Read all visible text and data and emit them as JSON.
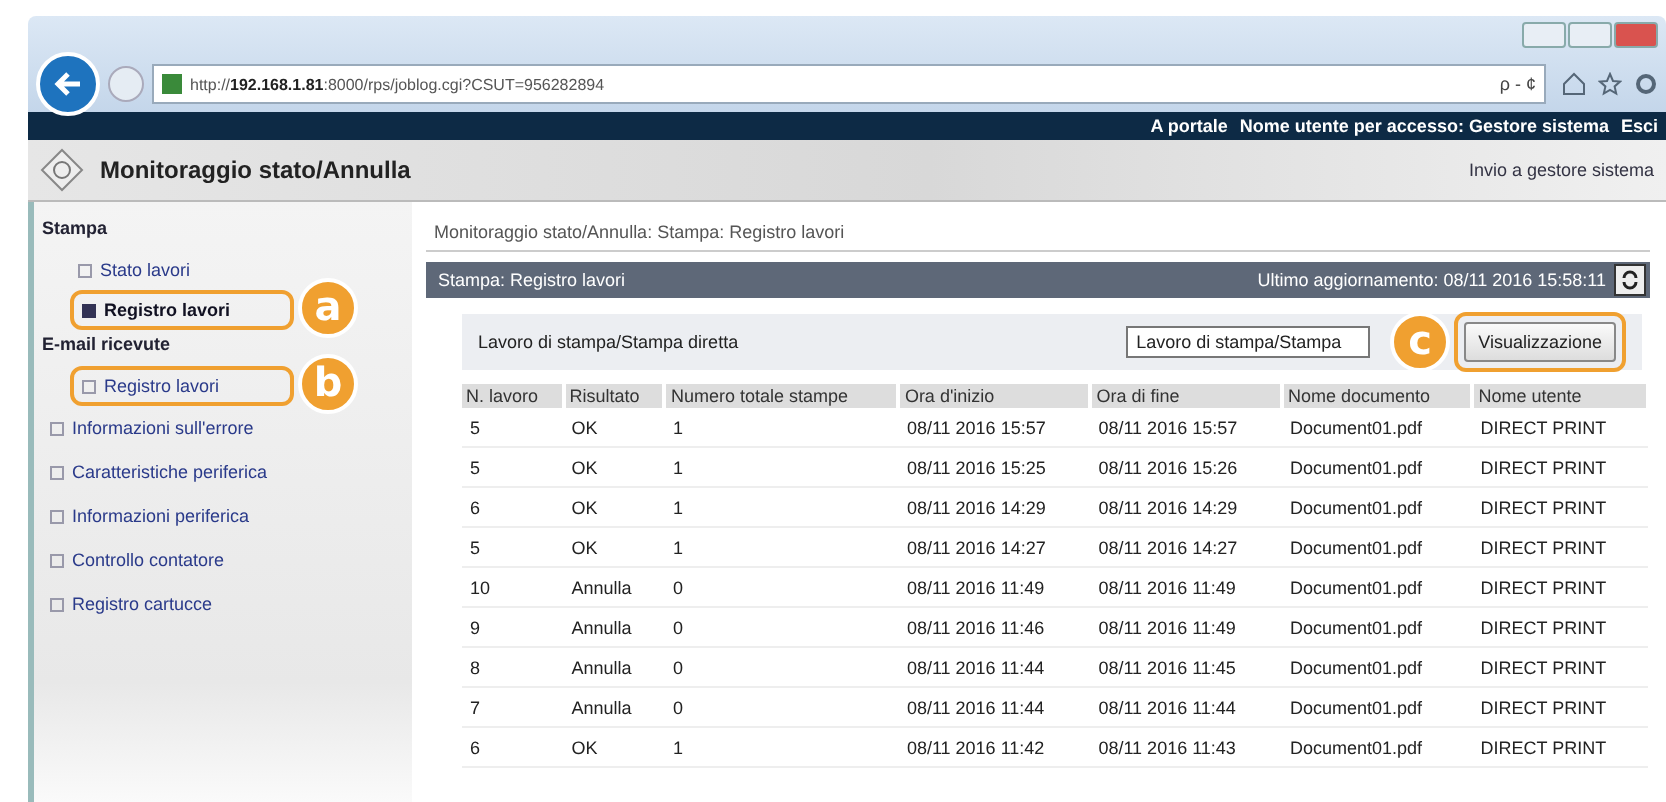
{
  "browser": {
    "url_prefix": "http://",
    "url_host": "192.168.1.81",
    "url_rest": ":8000/rps/joblog.cgi?CSUT=956282894",
    "search_glyph": "ρ - ¢"
  },
  "top_bar": {
    "links": [
      "A portale",
      "Nome utente per accesso: Gestore sistema",
      "Esci"
    ]
  },
  "header": {
    "title": "Monitoraggio stato/Annulla",
    "link": "Invio a gestore sistema"
  },
  "sidebar": {
    "items": [
      {
        "label": "Stampa",
        "kind": "section",
        "children": [
          {
            "label": "Stato lavori",
            "selected": false
          },
          {
            "label": "Registro lavori",
            "selected": true,
            "callout": "a"
          }
        ]
      },
      {
        "label": "E-mail ricevute",
        "kind": "section",
        "children": [
          {
            "label": "Registro lavori",
            "selected": false,
            "callout": "b"
          }
        ]
      },
      {
        "label": "Informazioni sull'errore",
        "kind": "link"
      },
      {
        "label": "Caratteristiche periferica",
        "kind": "link"
      },
      {
        "label": "Informazioni periferica",
        "kind": "link"
      },
      {
        "label": "Controllo contatore",
        "kind": "link"
      },
      {
        "label": "Registro cartucce",
        "kind": "link"
      }
    ]
  },
  "main": {
    "breadcrumb": "Monitoraggio stato/Annulla: Stampa: Registro lavori",
    "panel_title": "Stampa: Registro lavori",
    "updated": "Ultimo aggiornamento: 08/11 2016 15:58:11",
    "filter": {
      "label": "Lavoro di stampa/Stampa diretta",
      "value": "Lavoro di stampa/Stampa",
      "callout": "c",
      "button": "Visualizzazione"
    },
    "table": {
      "columns": [
        "N. lavoro",
        "Risultato",
        "Numero totale stampe",
        "Ora d'inizio",
        "Ora di fine",
        "Nome documento",
        "Nome utente"
      ],
      "rows": [
        [
          "5",
          "OK",
          "1",
          "08/11 2016 15:57",
          "08/11 2016 15:57",
          "Document01.pdf",
          "DIRECT PRINT"
        ],
        [
          "5",
          "OK",
          "1",
          "08/11 2016 15:25",
          "08/11 2016 15:26",
          "Document01.pdf",
          "DIRECT PRINT"
        ],
        [
          "6",
          "OK",
          "1",
          "08/11 2016 14:29",
          "08/11 2016 14:29",
          "Document01.pdf",
          "DIRECT PRINT"
        ],
        [
          "5",
          "OK",
          "1",
          "08/11 2016 14:27",
          "08/11 2016 14:27",
          "Document01.pdf",
          "DIRECT PRINT"
        ],
        [
          "10",
          "Annulla",
          "0",
          "08/11 2016 11:49",
          "08/11 2016 11:49",
          "Document01.pdf",
          "DIRECT PRINT"
        ],
        [
          "9",
          "Annulla",
          "0",
          "08/11 2016 11:46",
          "08/11 2016 11:49",
          "Document01.pdf",
          "DIRECT PRINT"
        ],
        [
          "8",
          "Annulla",
          "0",
          "08/11 2016 11:44",
          "08/11 2016 11:45",
          "Document01.pdf",
          "DIRECT PRINT"
        ],
        [
          "7",
          "Annulla",
          "0",
          "08/11 2016 11:44",
          "08/11 2016 11:44",
          "Document01.pdf",
          "DIRECT PRINT"
        ],
        [
          "6",
          "OK",
          "1",
          "08/11 2016 11:42",
          "08/11 2016 11:43",
          "Document01.pdf",
          "DIRECT PRINT"
        ]
      ]
    }
  }
}
